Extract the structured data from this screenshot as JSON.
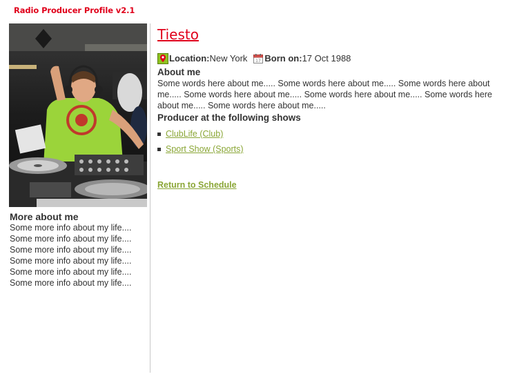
{
  "app": {
    "title": "Radio Producer Profile v2.1"
  },
  "producer": {
    "name": "Tiesto",
    "location_label": "Location:",
    "location": "New York",
    "born_label": "Born on:",
    "born": "17 Oct 1988",
    "photo_icon": "dj-photo"
  },
  "about": {
    "heading": "About me",
    "text": "Some words here about me..... Some words here about me..... Some words here about me..... Some words here about me..... Some words here about me..... Some words here about me..... Some words here about me....."
  },
  "shows": {
    "heading": "Producer at the following shows",
    "items": [
      {
        "label": "ClubLife (Club)"
      },
      {
        "label": "Sport Show (Sports)"
      }
    ]
  },
  "more_about": {
    "heading": "More about me",
    "lines": [
      "Some more info about my life....",
      "Some more info about my life....",
      "Some more info about my life....",
      "Some more info about my life....",
      "Some more info about my life....",
      "Some more info about my life...."
    ]
  },
  "nav": {
    "return_label": "Return to Schedule"
  },
  "colors": {
    "accent_red": "#e0001b",
    "link_green": "#8aa636",
    "text": "#333333"
  },
  "icons": {
    "location": "map-pin-icon",
    "born": "calendar-icon"
  }
}
